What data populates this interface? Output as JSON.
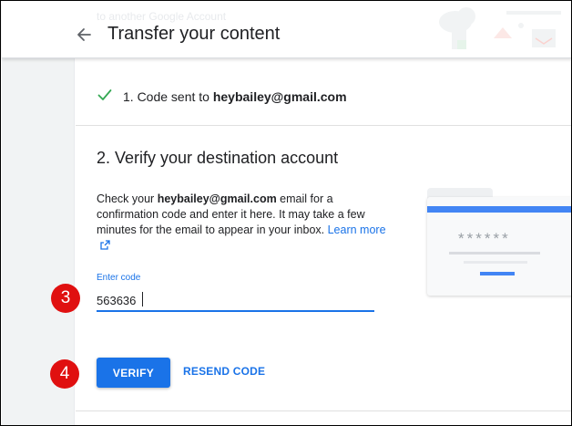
{
  "header": {
    "faded_text": "to another Google Account",
    "title": "Transfer your content",
    "back_icon": "arrow-back-icon"
  },
  "step1": {
    "check_icon": "checkmark-icon",
    "prefix": "1. Code sent to ",
    "email": "heybailey@gmail.com"
  },
  "step2": {
    "title": "2. Verify your destination account",
    "desc_prefix": "Check your ",
    "desc_email": "heybailey@gmail.com",
    "desc_suffix": " email for a confirmation code and enter it here. It may take a few minutes for the email to appear in your inbox. ",
    "learn_more": "Learn more",
    "code_label": "Enter code",
    "code_value": "563636",
    "verify_label": "VERIFY",
    "resend_label": "RESEND CODE"
  },
  "illustration": {
    "masked_code": "******"
  },
  "callouts": {
    "verify_field": "3",
    "verify_button": "4"
  },
  "colors": {
    "accent": "#1a73e8",
    "callout": "#e01010",
    "check": "#34a853"
  }
}
